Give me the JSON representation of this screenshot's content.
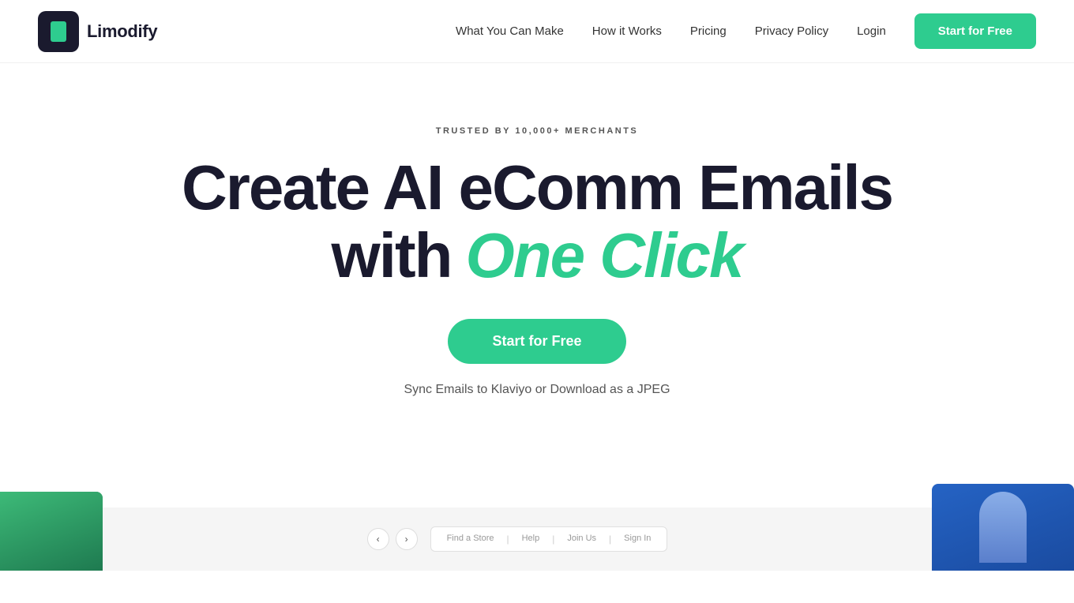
{
  "brand": {
    "name": "Limodify",
    "logo_alt": "Limodify logo"
  },
  "nav": {
    "links": [
      {
        "id": "what-you-can-make",
        "label": "What You Can Make"
      },
      {
        "id": "how-it-works",
        "label": "How it Works"
      },
      {
        "id": "pricing",
        "label": "Pricing"
      },
      {
        "id": "privacy-policy",
        "label": "Privacy Policy"
      },
      {
        "id": "login",
        "label": "Login"
      }
    ],
    "cta_label": "Start for Free"
  },
  "hero": {
    "badge": "TRUSTED BY 10,000+ MERCHANTS",
    "title_line1": "Create AI eComm Emails",
    "title_with": "with",
    "title_italic": "One Click",
    "cta_label": "Start for Free",
    "sub_text": "Sync Emails to Klaviyo or Download as a JPEG"
  },
  "screenshots": {
    "nav_items": [
      "Find a Store",
      "Help",
      "Join Us",
      "Sign In"
    ],
    "arrow_left": "‹",
    "arrow_right": "›"
  }
}
